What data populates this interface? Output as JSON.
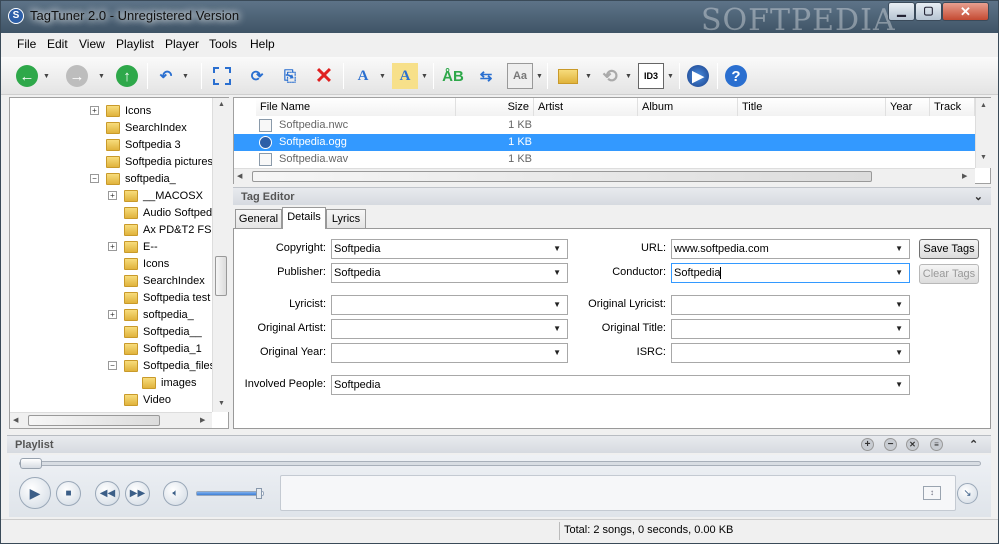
{
  "window": {
    "title": "TagTuner 2.0 - Unregistered Version",
    "app_icon_letter": "S",
    "watermark": "SOFTPEDIA",
    "min_glyph": "▁",
    "max_glyph": "▢",
    "close_glyph": "✕"
  },
  "menu": [
    "File",
    "Edit",
    "View",
    "Playlist",
    "Player",
    "Tools",
    "Help"
  ],
  "tree": {
    "items": [
      {
        "label": "Icons",
        "level": 0,
        "expander": "+"
      },
      {
        "label": "SearchIndex",
        "level": 0,
        "expander": ""
      },
      {
        "label": "Softpedia 3",
        "level": 0,
        "expander": ""
      },
      {
        "label": "Softpedia pictures",
        "level": 0,
        "expander": ""
      },
      {
        "label": "softpedia_",
        "level": 0,
        "expander": "−"
      },
      {
        "label": "__MACOSX",
        "level": 1,
        "expander": "+"
      },
      {
        "label": "Audio Softpedia",
        "level": 1,
        "expander": ""
      },
      {
        "label": "Ax PD&T2 FSE",
        "level": 1,
        "expander": ""
      },
      {
        "label": "E--",
        "level": 1,
        "expander": "+"
      },
      {
        "label": "Icons",
        "level": 1,
        "expander": ""
      },
      {
        "label": "SearchIndex",
        "level": 1,
        "expander": ""
      },
      {
        "label": "Softpedia test",
        "level": 1,
        "expander": ""
      },
      {
        "label": "softpedia_",
        "level": 1,
        "expander": "+"
      },
      {
        "label": "Softpedia__",
        "level": 1,
        "expander": ""
      },
      {
        "label": "Softpedia_1",
        "level": 1,
        "expander": ""
      },
      {
        "label": "Softpedia_files",
        "level": 1,
        "expander": "−"
      },
      {
        "label": "images",
        "level": 2,
        "expander": ""
      },
      {
        "label": "Video",
        "level": 1,
        "expander": ""
      }
    ]
  },
  "files": {
    "columns": [
      "File Name",
      "Size",
      "Artist",
      "Album",
      "Title",
      "Year",
      "Track"
    ],
    "rows": [
      {
        "name": "Softpedia.nwc",
        "size": "1 KB",
        "selected": false
      },
      {
        "name": "Softpedia.ogg",
        "size": "1 KB",
        "selected": true
      },
      {
        "name": "Softpedia.wav",
        "size": "1 KB",
        "selected": false
      }
    ]
  },
  "tag_editor": {
    "title": "Tag Editor",
    "tabs": [
      "General",
      "Details",
      "Lyrics"
    ],
    "active_tab": "Details",
    "fields": {
      "copyright": {
        "label": "Copyright:",
        "value": "Softpedia"
      },
      "publisher": {
        "label": "Publisher:",
        "value": "Softpedia"
      },
      "lyricist": {
        "label": "Lyricist:",
        "value": ""
      },
      "original_artist": {
        "label": "Original Artist:",
        "value": ""
      },
      "original_year": {
        "label": "Original Year:",
        "value": ""
      },
      "url": {
        "label": "URL:",
        "value": "www.softpedia.com"
      },
      "conductor": {
        "label": "Conductor:",
        "value": "Softpedia"
      },
      "original_lyricist": {
        "label": "Original Lyricist:",
        "value": ""
      },
      "original_title": {
        "label": "Original Title:",
        "value": ""
      },
      "isrc": {
        "label": "ISRC:",
        "value": ""
      },
      "involved_people": {
        "label": "Involved People:",
        "value": "Softpedia"
      }
    },
    "save_label": "Save Tags",
    "clear_label": "Clear Tags"
  },
  "playlist": {
    "title": "Playlist",
    "volume_level": 0.95,
    "seek_position": 0.0
  },
  "status": {
    "text": "Total: 2 songs, 0 seconds, 0.00 KB"
  },
  "colors": {
    "selection": "#3399ff",
    "back_button": "#2ea84a",
    "up_button": "#2ea84a",
    "delete": "#e02020",
    "help": "#2a6fd0"
  },
  "icons": [
    "back-icon",
    "forward-icon",
    "up-icon",
    "undo-icon",
    "select-icon",
    "refresh-tags-icon",
    "save-tags-icon",
    "delete-icon",
    "edit-tag-icon",
    "rename-icon",
    "spell-icon",
    "move-icon",
    "case-icon",
    "folders-icon",
    "sync-icon",
    "id3-icon",
    "media-player-icon",
    "help-icon"
  ]
}
